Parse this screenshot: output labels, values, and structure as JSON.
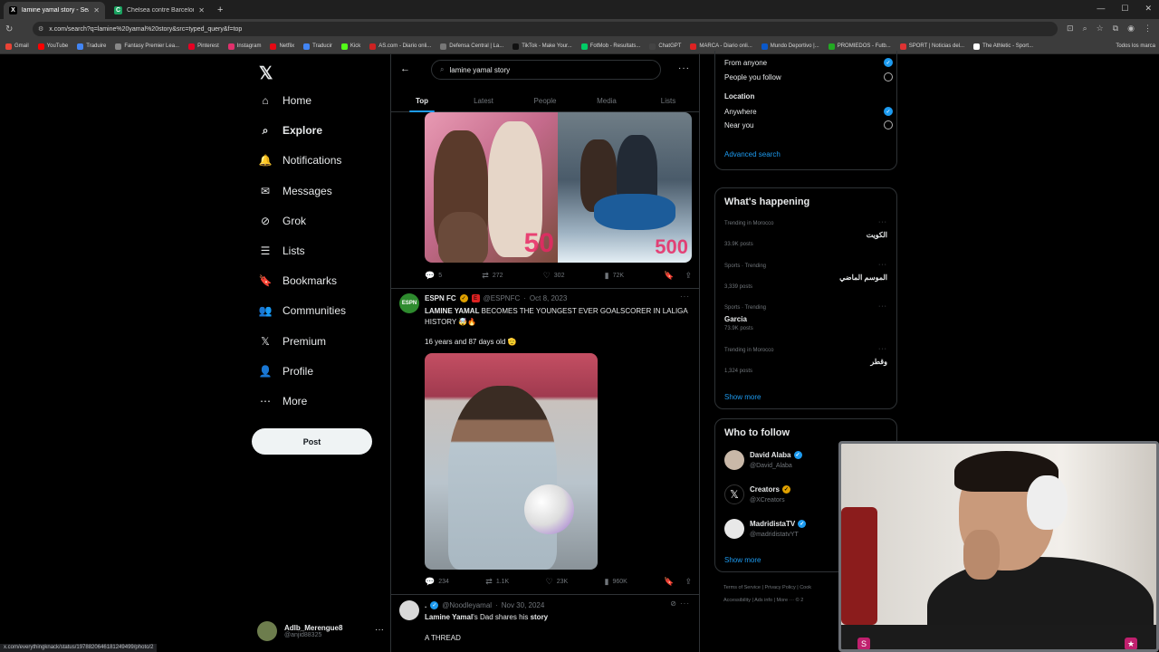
{
  "browser": {
    "tabs": [
      {
        "title": "lamine yamal story - Search / X",
        "favicon": "X",
        "active": true
      },
      {
        "title": "Chelsea contre Barcelona - sco",
        "favicon": "C",
        "active": false
      }
    ],
    "url": "x.com/search?q=lamine%20yamal%20story&src=typed_query&f=top",
    "bookmarks": [
      "Gmail",
      "YouTube",
      "Traduire",
      "Fantasy Premier Lea...",
      "Pinterest",
      "Instagram",
      "Netflix",
      "Traducir",
      "Kick",
      "AS.com - Diario onli...",
      "Defensa Central | La...",
      "TikTok - Make Your...",
      "FotMob - Resultats...",
      "ChatGPT",
      "MARCA - Diario onli...",
      "Mundo Deportivo |...",
      "PROMIEDOS - Futb...",
      "SPORT | Noticias del...",
      "The Athletic - Sport..."
    ],
    "bookmarks_all": "Todos los marca",
    "status_url": "x.com/everythingknack/status/1978820646181249499/photo/2"
  },
  "nav": {
    "items": [
      {
        "label": "Home",
        "icon": "home-icon",
        "glyph": "⌂"
      },
      {
        "label": "Explore",
        "icon": "search-icon",
        "glyph": "⌕",
        "bold": true
      },
      {
        "label": "Notifications",
        "icon": "bell-icon",
        "glyph": "🔔"
      },
      {
        "label": "Messages",
        "icon": "mail-icon",
        "glyph": "✉"
      },
      {
        "label": "Grok",
        "icon": "grok-icon",
        "glyph": "⊘"
      },
      {
        "label": "Lists",
        "icon": "list-icon",
        "glyph": "☰"
      },
      {
        "label": "Bookmarks",
        "icon": "bookmark-icon",
        "glyph": "🔖"
      },
      {
        "label": "Communities",
        "icon": "communities-icon",
        "glyph": "👥"
      },
      {
        "label": "Premium",
        "icon": "x-premium-icon",
        "glyph": "𝕏"
      },
      {
        "label": "Profile",
        "icon": "profile-icon",
        "glyph": "👤"
      },
      {
        "label": "More",
        "icon": "more-circle-icon",
        "glyph": "⋯"
      }
    ],
    "post_label": "Post",
    "account": {
      "name": "Adlb_Merengue8",
      "handle": "@anjid88325"
    }
  },
  "search": {
    "query": "lamine yamal story",
    "tabs": [
      "Top",
      "Latest",
      "People",
      "Media",
      "Lists"
    ],
    "active_tab": "Top"
  },
  "tweets": [
    {
      "media_labels": [
        "50",
        "500"
      ],
      "stats": {
        "replies": "5",
        "reposts": "272",
        "likes": "302",
        "views": "72K"
      }
    },
    {
      "name": "ESPN FC",
      "handle": "@ESPNFC",
      "date": "Oct 8, 2023",
      "text_bold": "LAMINE YAMAL",
      "text_rest": " BECOMES THE YOUNGEST EVER GOALSCORER IN LALIGA HISTORY 🤯🔥",
      "text2": "16 years and 87 days old 🫡",
      "stats": {
        "replies": "234",
        "reposts": "1.1K",
        "likes": "23K",
        "views": "960K"
      }
    },
    {
      "name": ".",
      "handle": "@Noodleyamal",
      "date": "Nov 30, 2024",
      "text_bold1": "Lamine Yamal",
      "text_mid": "'s Dad shares his ",
      "text_bold2": "story",
      "text2": "A THREAD"
    }
  ],
  "filters": {
    "people_options": [
      {
        "label": "From anyone",
        "selected": true
      },
      {
        "label": "People you follow",
        "selected": false
      }
    ],
    "location_heading": "Location",
    "location_options": [
      {
        "label": "Anywhere",
        "selected": true
      },
      {
        "label": "Near you",
        "selected": false
      }
    ],
    "advanced": "Advanced search"
  },
  "happening": {
    "title": "What's happening",
    "trends": [
      {
        "context": "Trending in Morocco",
        "name": "الكويت",
        "posts": "33.9K posts",
        "rtl": true
      },
      {
        "context": "Sports · Trending",
        "name": "الموسم الماضي",
        "posts": "3,339 posts",
        "rtl": true
      },
      {
        "context": "Sports · Trending",
        "name": "Garcia",
        "posts": "73.9K posts",
        "rtl": false
      },
      {
        "context": "Trending in Morocco",
        "name": "وقطر",
        "posts": "1,324 posts",
        "rtl": true
      }
    ],
    "show_more": "Show more"
  },
  "who_to_follow": {
    "title": "Who to follow",
    "accounts": [
      {
        "name": "David Alaba",
        "handle": "@David_Alaba"
      },
      {
        "name": "Creators",
        "handle": "@XCreators"
      },
      {
        "name": "MadridistaTV",
        "handle": "@madridistatvYT"
      }
    ],
    "show_more": "Show more"
  },
  "footer_links": [
    "Terms of Service",
    "Privacy Policy",
    "Cook",
    "Accessibility",
    "Ads info",
    "More ···",
    "© 2"
  ],
  "colors": {
    "accent": "#1d9bf0",
    "bg": "#000000",
    "border": "#2f3336",
    "muted": "#71767b"
  }
}
